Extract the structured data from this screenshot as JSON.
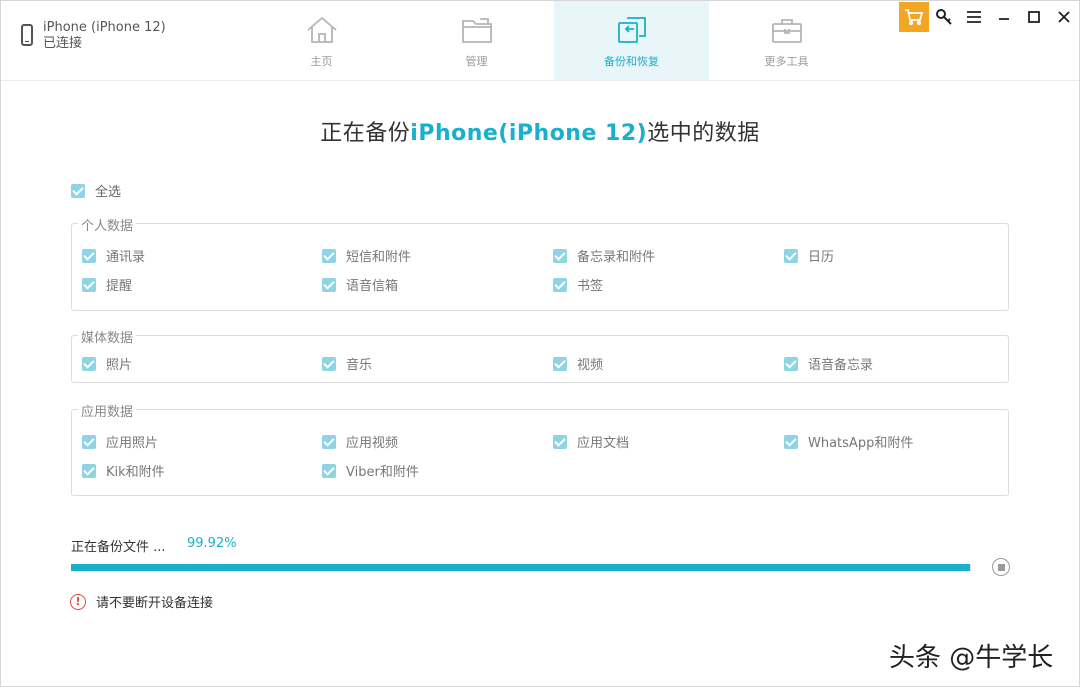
{
  "device": {
    "name": "iPhone (iPhone 12)",
    "status": "已连接"
  },
  "tabs": [
    {
      "label": "主页",
      "icon": "home-icon",
      "active": false
    },
    {
      "label": "管理",
      "icon": "folder-icon",
      "active": false
    },
    {
      "label": "备份和恢复",
      "icon": "backup-restore-icon",
      "active": true
    },
    {
      "label": "更多工具",
      "icon": "toolbox-icon",
      "active": false
    }
  ],
  "window_controls": [
    "cart-icon",
    "key-icon",
    "menu-icon",
    "minimize-icon",
    "maximize-icon",
    "close-icon"
  ],
  "title": {
    "prefix": "正在备份",
    "device": "iPhone(iPhone 12)",
    "suffix": "选中的数据"
  },
  "select_all": "全选",
  "groups": [
    {
      "legend": "个人数据",
      "items": [
        "通讯录",
        "短信和附件",
        "备忘录和附件",
        "日历",
        "提醒",
        "语音信箱",
        "书签"
      ]
    },
    {
      "legend": "媒体数据",
      "items": [
        "照片",
        "音乐",
        "视频",
        "语音备忘录"
      ]
    },
    {
      "legend": "应用数据",
      "items": [
        "应用照片",
        "应用视频",
        "应用文档",
        "WhatsApp和附件",
        "Kik和附件",
        "Viber和附件"
      ]
    }
  ],
  "progress": {
    "label": "正在备份文件 ...",
    "percent_text": "99.92%",
    "value": 99.92
  },
  "warning": "请不要断开设备连接",
  "watermark": "头条 @牛学长",
  "colors": {
    "accent": "#1ab0cc",
    "checkbox": "#8fd4e2",
    "cart": "#f2a623",
    "warning": "#e04a3f"
  }
}
